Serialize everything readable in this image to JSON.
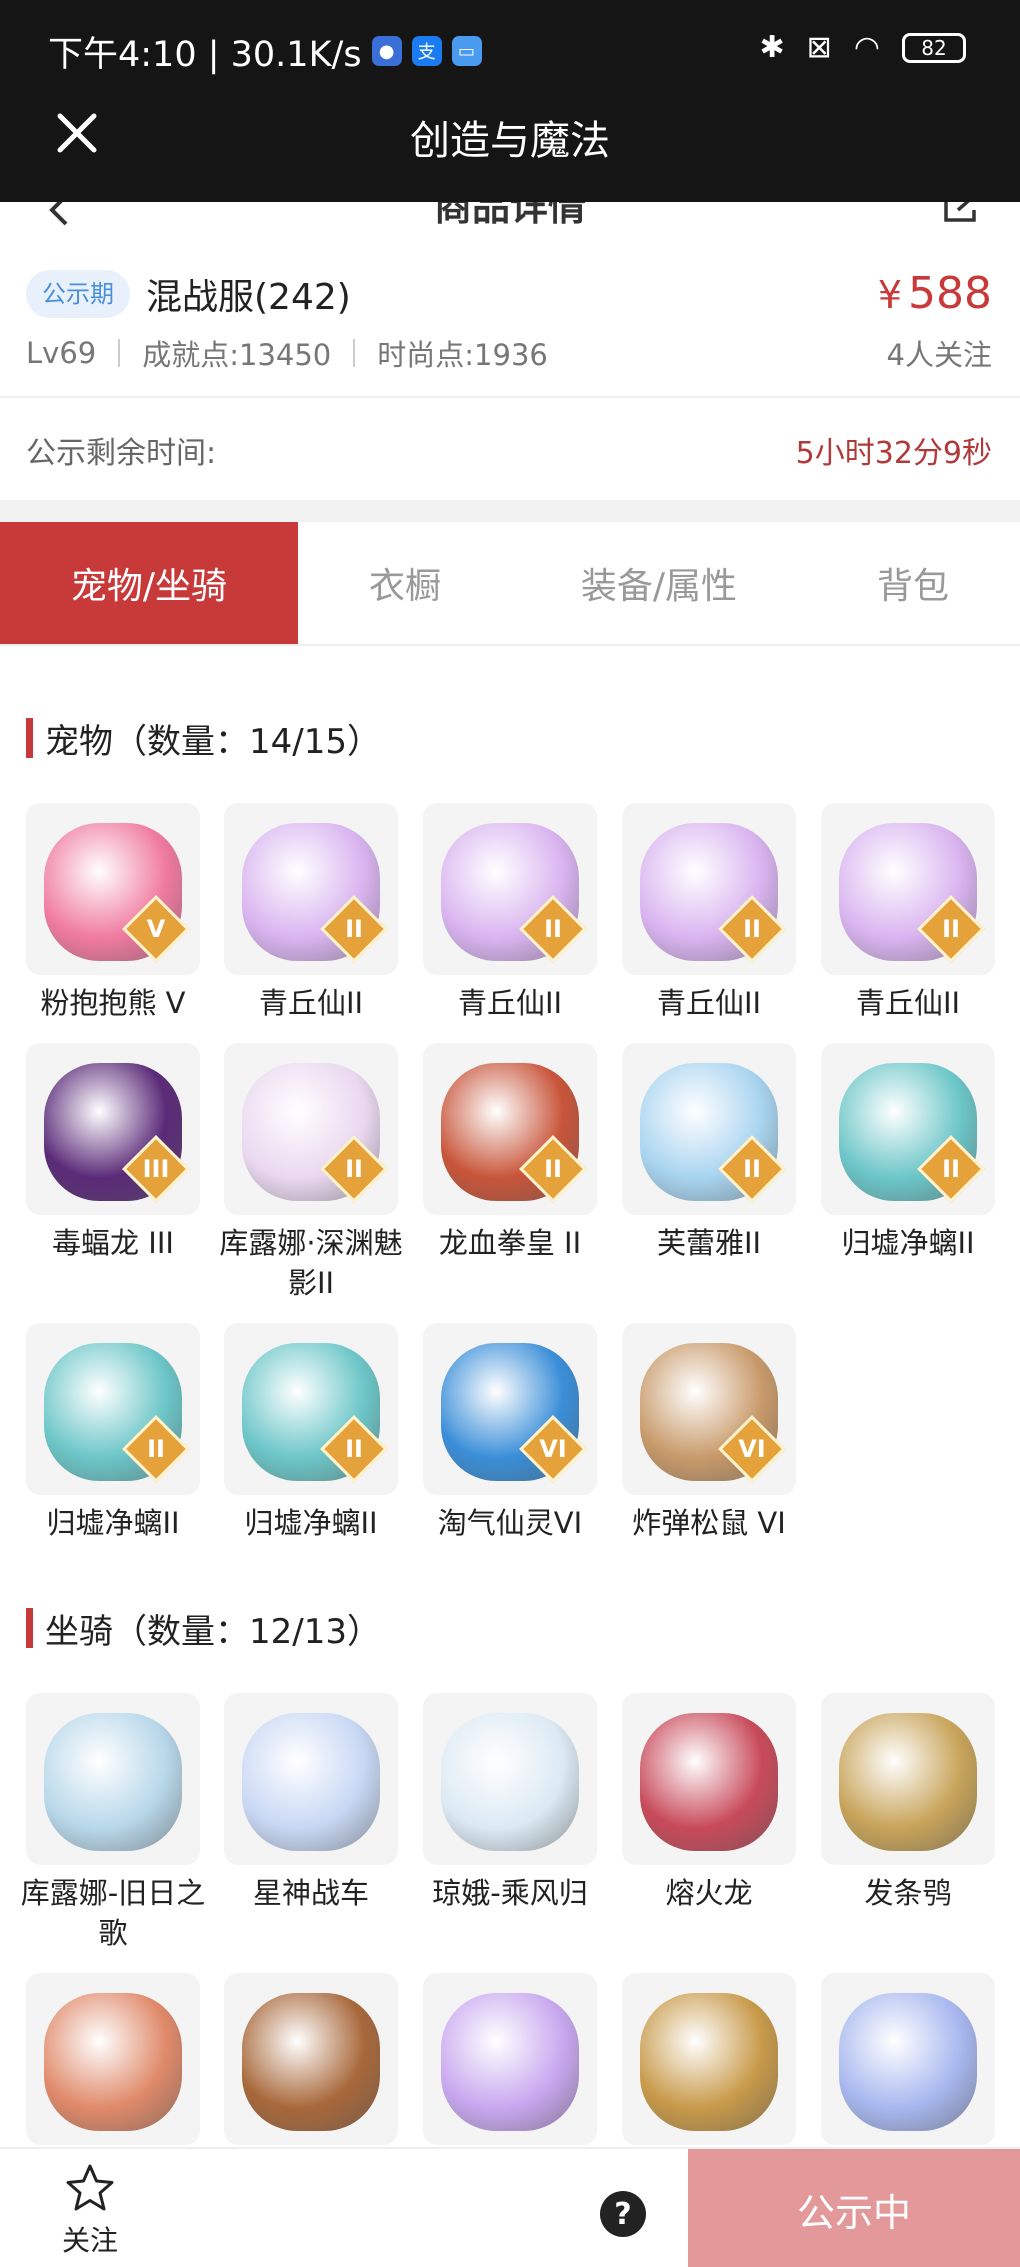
{
  "status_bar": {
    "time_speed": "下午4:10 | 30.1K/s",
    "battery": "82"
  },
  "app_bar": {
    "title": "创造与魔法"
  },
  "subpage": {
    "title": "商品详情"
  },
  "product": {
    "tag": "公示期",
    "name": "混战服(242)",
    "price_symbol": "¥",
    "price": "588",
    "level": "Lv69",
    "achievement": "成就点:13450",
    "fashion": "时尚点:1936",
    "followers": "4人关注",
    "remain_label": "公示剩余时间:",
    "remain_value": "5小时32分9秒"
  },
  "tabs": [
    "宠物/坐骑",
    "衣橱",
    "装备/属性",
    "背包"
  ],
  "pets": {
    "title": "宠物（数量：14/15）",
    "items": [
      {
        "label": "粉抱抱熊 V",
        "grade": "V",
        "color": "#f07aa0"
      },
      {
        "label": "青丘仙II",
        "grade": "II",
        "color": "#d9b4f0"
      },
      {
        "label": "青丘仙II",
        "grade": "II",
        "color": "#d9b4f0"
      },
      {
        "label": "青丘仙II",
        "grade": "II",
        "color": "#d9b4f0"
      },
      {
        "label": "青丘仙II",
        "grade": "II",
        "color": "#d9b4f0"
      },
      {
        "label": "毒蝠龙 III",
        "grade": "III",
        "color": "#5a2a78"
      },
      {
        "label": "库露娜·深渊魅影II",
        "grade": "II",
        "color": "#ead8f0"
      },
      {
        "label": "龙血拳皇 II",
        "grade": "II",
        "color": "#c8553a"
      },
      {
        "label": "芙蕾雅II",
        "grade": "II",
        "color": "#a8d4f0"
      },
      {
        "label": "归墟净螭II",
        "grade": "II",
        "color": "#6cc6c8"
      },
      {
        "label": "归墟净螭II",
        "grade": "II",
        "color": "#6cc6c8"
      },
      {
        "label": "归墟净螭II",
        "grade": "II",
        "color": "#6cc6c8"
      },
      {
        "label": "淘气仙灵VI",
        "grade": "VI",
        "color": "#3a8ed8"
      },
      {
        "label": "炸弹松鼠 VI",
        "grade": "VI",
        "color": "#c89a6a"
      }
    ]
  },
  "mounts": {
    "title": "坐骑（数量：12/13）",
    "items": [
      {
        "label": "库露娜-旧日之歌",
        "color": "#b8d8ea"
      },
      {
        "label": "星神战车",
        "color": "#c8d8f4"
      },
      {
        "label": "琼娥-乘风归",
        "color": "#dceaf4"
      },
      {
        "label": "熔火龙",
        "color": "#c84a5a"
      },
      {
        "label": "发条鸮",
        "color": "#c8a45a"
      },
      {
        "label": "",
        "color": "#e08a6a"
      },
      {
        "label": "",
        "color": "#a8683a"
      },
      {
        "label": "",
        "color": "#c8a8f0"
      },
      {
        "label": "",
        "color": "#c89a4a"
      },
      {
        "label": "",
        "color": "#a8b8f0"
      }
    ]
  },
  "bottom": {
    "follow": "关注",
    "help": "?",
    "action": "公示中"
  }
}
